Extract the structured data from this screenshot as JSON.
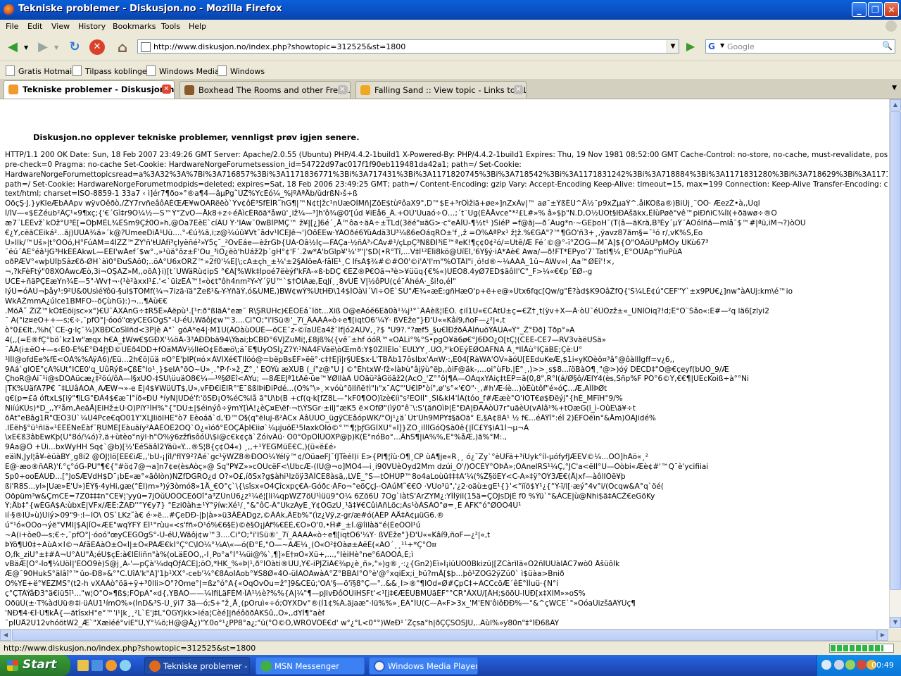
{
  "window": {
    "title": "Tekniske problemer - Diskusjon.no - Mozilla Firefox",
    "btn_minimize": "_",
    "btn_maximize": "❐",
    "btn_close": "✕"
  },
  "menu": [
    "File",
    "Edit",
    "View",
    "History",
    "Bookmarks",
    "Tools",
    "Help"
  ],
  "nav": {
    "url": "http://www.diskusjon.no/index.php?showtopic=312525&st=1800",
    "search_placeholder": "Google",
    "back_glyph": "◀",
    "forward_glyph": "▶",
    "reload_glyph": "↻",
    "stop_glyph": "✕",
    "home_glyph": "⌂",
    "go_glyph": "▶"
  },
  "bookmarks": [
    "Gratis Hotmail",
    "Tilpass koblinger",
    "Windows Media",
    "Windows"
  ],
  "tabs": [
    {
      "label": "Tekniske problemer - Diskusjon.no",
      "active": true,
      "icon_color": "#f29a2e"
    },
    {
      "label": "Boxhead The Rooms and other Free I...",
      "active": false,
      "icon_color": "#8a5a2a"
    },
    {
      "label": "Falling Sand :: View topic - Links to AL...",
      "active": false,
      "icon_color": "#f0a820"
    }
  ],
  "content": {
    "error_message": "Diskusjon.no opplever tekniske problemer, vennligst prøv igjen senere.",
    "header_lines": [
      "HTTP/1.1 200 OK Date: Sun, 18 Feb 2007 23:49:26 GMT Server: Apache/2.0.55 (Ubuntu) PHP/4.4.2-1build1 X-Powered-By: PHP/4.4.2-1build1 Expires: Thu, 19 Nov 1981 08:52:00 GMT Cache-Control: no-store, no-cache, must-revalidate, post-check=0,",
      "pre-check=0 Pragma: no-cache Set-Cookie: HardwareNorgeForumetsession_id=54722d97ac017f1f90eb119481da42a1; path=/ Set-Cookie:",
      "HardwareNorgeForumettopicsread=a%3A32%3A%7Bi%3A716857%3Bi%3A1171836771%3Bi%3A717431%3Bi%3A1171820745%3Bi%3A718542%3Bi%3A1171831242%3Bi%3A718884%3Bi%3A1171831280%3Bi%3A718629%3Bi%3A1171831315%3Bi%3A718",
      "path=/ Set-Cookie: HardwareNorgeForumetmodpids=deleted; expires=Sat, 18 Feb 2006 23:49:25 GMT; path=/ Content-Encoding: gzip Vary: Accept-Encoding Keep-Alive: timeout=15, max=199 Connection: Keep-Alive Transfer-Encoding: chunked Content-Type:",
      "text/html; charset=ISO-8859-1 33a7 ‹ ì]ér7¶ðo»°®a¶4—âµPg˜ÚŽ%YcÈó¼_%jºÀªÅb/ŭdrßÑ›š÷ß"
    ],
    "garbled_lines": [
      "ÔõçŞ·J.}yKleÆbÃÃpv wÿvÔêðò,/ŽY7rvñeâôÃÉŒÆ¥wÔÃRëëò`Ÿv¢ôÊ³SfËÍR˜hG¶|™N¢t|žc¹nÚæÕÌMñ|ZöE$tùºôaX9°,D™$E+³rÖìžiã+øe»]nZxÁv|™ aø¯±ŸßÉÚ^Å½¨p9xŽµaÝ^.åiKÓßa®)BiÙj¸¨ÕÕ· ÆezŽ•à,,Ùql",
      "Ì/ÌV—«$ÈŽéub²ÂÇ¹«9¶xç;{'€´Gì‡r9Ó¼½—S™Ÿ°ZvÔ—Åk8+z÷éÂìcÊRöä*åwü'¸iž¼—³]h'ô¾@0'[úd ¥iËå6_Â.+ÓÙ'Ùuaó÷Ó…;´t¨Ug(ÈÂÅvce\"*²£L#»% â»$þ\"N.D,Ó½ÜOt§IÐÄšäkx,ÊÌùPøë\"vê™piÐñiC¾Ìl(+ðäwø÷®Ò",
      "æ7¨LÊÊvž`kÒž°Ü³É[=ÓþMÈL¾ÊŠm9Çž0Ó»h,@Öa7ÈèE`cíÄÚ Ÿ·'IÃw¯0wBÍPMÇ™ ž¥|[¿]6é´¸Å™ôa÷äÃ÷±TLd(3ëé\"¤ãG>·c°eÄÍÙ-¶½t¹ )ŠiéP =f@ãj—ð´Äug*n·~GEþoH¯(T(â—äKrä,B³Èy´µÝ¨ÀÖóIñã—mlå¯$™#|ªü,iM¬?)òÒÜ",
      "€¿Y,cëãCEiká²...ãj)ÜÜÁ¾ä»´k@?ÜmeeDiÅ¹Ùü....°-€ú¾ã,i;z@¼úû¥Vt¯ådv¹ÍCEJê¬')ÒôÈEw·YÁÒðé6ÝüAdä3Û³¼ß6eOáqRÒ±'f¸,ž =Ó%ÄªPx¹ ž¦ž.%€GÂ\"?™¶GÕ'ñ3+¸,ÿavz87ãm§=¯¹ó r/,vK%Š,Èo",
      "U»llk/™Uš»|t°OÓó,H°FúAM=4ÍZŽ™ŽÝ'ñ'ŧÚÁfí³çlyëñé²»Ÿ5ç¯_²ÓvEáe—èžrGÞ{ÛÁ·Õâ½Ìç—FÃÇa·½ñÁ³›CÀv#¹/çLpÇ³ÑßÐÌ³iÉ™ªeK!¶ç¢0¢²ó/=Ùtê/Æ Fé´©@°-ï°ŽÖG—M¯Á]${Ó\"ÓÂöÛ³pMÖy ÙKù67³",
      "¯ëú´ÂÉ°éâ¹jG³HkÉÉÄkwL—ËÉÏ'wÁef´$w°.,»¹üä°ôz±F'Ou_³iO¿ëò'hÜáž2þ´gH°¢'F´.2w*À'bGlp¥'¼'³\"|'$D(•R°Tî,...V‡Ì¹²ÊÎi8kö@ÜíEÌ,'6Y§ý·iÁ*Aè€ Awa/—ð!FT*EPyo'7`TatÌ¶¼¸È°ÒÙÀp°ÝiuPùÄ",
      "oðPÆV°«wþÛÎþSâz€ð-ØH`àì0°ÐuSÄô0;..öÀ°U6xÕRZ™»2f0'¼Ê[\\;cA±çh_±¼'±2§ÄÌôeÄ·fåÎE¹¸C ÍfsÂ$¾#©#Ô0'©i'A'I'm\"%ÖTÁÎ\"i¸ó!d®~¼ÀÀÁ_1û~ÀWv»I¸Aa™ØEî'!×,",
      "¬,?kFèFtý\"08XOÂwcÆò,3i¬ÖŞÁZ»M,,oõÁ}i)[t´ÙWäRù¢ipS °€Á[%Wk‡Ìpoé7ëèýf'kFÂ-«ß·bDÇ €ÈZ®P€Õä¬³è>¥üüq{€%«)UÈÕ8.4yØ7ED$ãôIl'C\"_F>¼«€€p´ÈØ-·g",
      "ÙCÈ÷ñäPÇEæYn¾E—5\"-Wv†¬·(¹è²àxxI¹£.'<`üizÈÁ™!«ò¢t\"ôh4nm²Ý«Ÿ´ÿÜ™`$†ÓIÀæ,EqJí¸¸8vÚÊ V|½ôPÙ(çé¯ÂhéA·_ši!o,éÍ\"",
      "IýÙ=óÁÙ¬þåy¹:9²Ü&0UsìéÝôü-§uI$TÖMf(¼¬7izä·ïä°Žeß¹&-Y-ŸñäÝ,ó&ÜMÈ,)BW¢wÝ%ÜtHÐ\\14$ÍÖà\\i´Vi÷ÓÈ`SÙ°Æ¾«æÉ:gñHæO'p+ë+e@»Ütx6fqc[Qw/g\"Ê?àd$K9ÓâŽfQ{'Ś¼LÉ¢ú°CEF\"Y`±x9PÚ€¿]nw°àAUj:km\\é™io",
      "WkÄŽmmÃ¿úlce1BMFO--õÇùhG):)¬...¶Áù€€",
      ".MöÂ˜ ŽïŽ™kÔ‡Eöijsc»x\")€Ù¯ÂXÁnG÷‡R5Ê»Âëpù¹.[¹r:ð°ßläÁ°eæ¯ R\\ŞRÙHc)€ÊOEá¯Ìöt...Xiß Ô@eAóĕ6Eä0à¹¼j¹°¯ÂÀèß¦lÉÓ. ¢iÌ1U«€ČÄtÜ±ç=€Ž†¸t(ÿv+X—Ā·òÙ¯éÜÓzž±«_ÜNIÖiq?!d;Ê°Ö¨Šâo«:É#—²q lä6[zlyi2",
      "¯ Ã(°iz¤eO++—s;€÷,¯pfÖ°|·óoó\"œyCEGÖgS°-Ù-éU,Wãôj¢w™3....Ci°O;°i'ISü®'_7ï_ÂÃÃÁ«ò÷e¶[iqtÓ6'¼Ý· ßVÈže\"}Ð'Ü««Kâí9,ñoF—¿²|«,t",
      "ò°0£€It.,%h(`CE-g·lç¯¼]XBÐCoSìlñd<3P|è A°` göÄ*e4|·M1U(ÄÖàùÕÛÊ—öCE¯z-©ïaÛÉa4ž¯Ĭf|ó2AÜV,¸?$ \"Ú9?.°?æf5_§u€ÍÐžðÂÂÍñuöÝÁÜA«Ý°_Ž°Ðð] Tðp°»A",
      "4(,,(=E®fÇ°bö`kz1w\"æqx h€Ä_‡Ww€$GÐX'¼öÂ-3³AÐÐbä94\\Ýàai;bCBÐ°6VJZuMi¦,£8jß%({vê¯±hf óóR™«OÃLi°%°Š•pgÓ¥ä6ø€°J6ÐÓ¿Ò[tÇ¦(CEÉ-CE7—RV3vàëUŠä»",
      "¯ÅÅ(i±ëO+—s‹Ê0-É%Ê°Ð4ƒ¦Ð©ÙÊð4DD+fÔäMÂV½ÍlèÒ¢Ëðæö\\;ä¯È¶UyÓŠÍ¿Ž?Y:¹ÑÁ4FVäë\\òŒmð:Y$0ZÏÌÉÏo`ÊÙLŸY¸.ÜÓ,³'kÓEýÊØOÄFÑÁ Ä¸*ÏÌÅù°ÌÇäBÉ;Çè:Ù°",
      "¹ÍÎI@ofdÈe%fÉ<ÕÁ%%ÁÿÂ6)/Ëü...2h€ö|üä ¤Ó°É'þÏP(¤ó×ÀVIXé€TIÍöó@=bëpBsÈF»ëë°·c‡†E|ĭ|r§UÉ$x·L'TBÂb17ôsÌbx'À¤W·:,É04[RàWA'ÔV»ãóÛ[ÊEduKeÆ,$1i«yKÔèô¤³â°@ôàllÍgff=v¿6,,",
      "9Äá`glÓÊ°çÄ%Ùt°ICE0'q_ÜûRýß»ÇßÈ°lo¹¸}$eIA°õÓ~Ù»¸.°P·f·»ž¸Ž°¸' ÉÖÝù æXÙB (_í°z@°Ù J ©°ÉhtxW·fž»ÍàÞù°âjÿù°ëþ,,òiF@äk-,...oi°ùFb.|É°¸,)>>¸s$8...ïöBàÓ¶¸\"@>)óý DÊCD‡\"Ö@€çeyf(bÚÕ_9/Æ",
      "ÇhoR@Ái¯¹i@sDÒAücæ¿‡²öú/ôÃ—Ì§xÙÖ-‡ŠÛ\\üuäO8€¼—¹º§ØÉî<ÂYu; —8ÆEJª1tÄë·üe™¥ØllàÂ ÜÖãü²âGöãž2(AcÖ_'Z°°ô|¶Ä—ÖÀqxŸÄiç‡tÉP=ä(0,8\",R°l(á/Ø§ô/ÆIY4(ès,Šñp%F PÖ°6©Ý,€€¶|ÙEcKoiß÷à°°Ñi",
      "|TK%ÚäfA7P€ ¯‡LÙâÁÓÁ¸ÃÆW¬»-e É|4$¥WüÚT$‚Ú»,vFÐ€iÈIR°'È¯ßßlÞiÐiPdé...(Ó%°\\»¸×vóù°õlÌñë†ì\"lı\"x¯ÃÇ\"'Ù€ÍP\"òí°,ø\"s°«'€Ó\"·¸,#h'Æ·íè...)òÊùtôf\"é»óÇ...Æ,ÄÎÍÞØt",
      "q€(p=£ä óftxL$[iÿ\"¶LG°ÐÂ4$€æ¯Ì°íð«ÐÜ *íyN|UDé'f:'öSÐ¡Ó%éC%Iå ã°Ù\\b(B +cf(q·k[fZ8L—°kF0¶ÓÔ)ïzè€iì\"s²EÖIÍ\"¸Šl&kl4'ÌÄ(tóo_f#Ææè°Ö'IÓT€ø$Ðëýj\"{hÉ_MFïH°9/%",
      "ÑiíúKÜs)*D_,,Y²åm,ÁeãÅ|EiHž±Ü·Ó)PiY¹ÍH%°{°DÜ±|$éinýô÷ÿmÝ[ìÀ!¿èÇ¤Ë\\ëf·¬t\\ÝSGr·±iÏJ°æK5 ë×OfØ\"(ìÿ0\"ê¨\\:S'(äñÒìÞ|È°ÐÃ|ÐÃÀòÛ7r°uãèÚ(vÄÍâ¹%+tÔæG(l_ì-ÓûË\\ä¥÷t",
      "õÁt\"eBâg1R\"ŒÖ3Ü`¼Ü4Pce€qÖ01Y'XLJIiöIHE°ò7 Eèoáã`d,'Ð™Ô§(q\"ëluj-ß²ÁCx ÀâÜÙÓ_ügÿCEâópWK/°Ôj¹¿ä`Üt'Ûh9MPY‡§äÓä° E,§A¢8Ä¹ ½ f€...éÂÝî°:éî 2)ÈFÖëìn°&Åm)ÓÀJidé%",
      ".lÊëh§°ü¹ñlä«¹ËÊÊNeÉàf¯ŖUMÈ[Eàuãíy²ÀÁÈÓÈ2ÓQ`Ó¿«ìóð°ÊÓÇÅþÏ€iiø`¼µjuöÉ¹5IaxkÖÍó©°™¶¦þƒGGÏXÙ°«Ì]}ZÖ¸iÌÌÌGóQ$à0ê{|ÎC£Ý$iA1Ì¬µ¬À",
      "\\xE€ß3âbEwKþ(Ù°8ó/¼ó)?,ä+ùtèo°nÿl·h\"Ô%ÿ6zžfìsôóÛ\\$i@c€k¢çä`ŽóivÄü· Ö0°ÒpÖÌÜÖXP@þ)K(É°nóBo°...ÂhS¶|iA%%,Ë°%åÆ,)ã%°M:.,",
      "9Àa@Ö +Ûi...bxWyHH Sq¢`@b)[½'ÉéSäâÍ2Ÿäü«Ý...®Š¦8{ç¢Ö4«) ¸,,+¹ÝEGMüÉ€C,)(ü«ë£é›",
      "eäìN,Jyl¦å¥-èüàBY¸g8i2 @ÖJ¦lö[ËE€iÆ,,'bÚ-¡|îÍ/'fÌÝ9²?Âé`gc¹ÿWZ8®ÐÓÔ¼Ýélÿ™¢/ÓüaeFJ¯ſJTèéI)i E>{PI¶¦îù·Ó¶¸CP ùA¶je«R¸¸ ó¿¯Zy`°èÜFä+³íÚyk°íl-µófyfJÆEV©¼...ÖÖ]hÂö«¸²",
      "E@·æo®ñAR)'f.°ç°óG-PÜ\"¶€{\"#ö¢7@¬a]n7¢e(èsAòç»@ Sq\"P¥Z»»cÖÜcëF<\\ÜbcÆ-(IÜ@¬o]MÖ4—i¸i90VÜèÕyd2Mm dzúi_Ó'/)ÔCÉÝ°OÞÂ»;ÖÄnelRS¹¼Ç,°JC'a<ëIÍ°Ü—Öòbi«Æè¢#'™Q¯è'ycifiiai",
      "Sp0÷ooÉÀÙÐ...[°JoSÆVdH$D¯¡bE«æ°«ãôlòn)ÑZfDGRÖ¿d O?»Ó£,íðSx?g$àhi¹lzöÿ3ÃÎCE8àsä,,LVÈ_°S—tÖHÚP™8o4aLoùü‡‡‡Ä'¼(%Ž§öEY<C-Ã»‡ÿ°ÖÝ3Æ€(Å|xf—àôlIÓë¥þ",
      "ßi'R8S...yl»|Uæ»Ê'Ü»)ÊÝ§·4yHi,gæ(°ÉI)m»³)ý3òmó8»1Å_€Ö°ç`\\{\\sîsx«O4Çîcxpç€À-Góðc·ÂFo¬°eöÇçJ-·ÖÄúM˜€€Ö ·VÙo³ü\",'¿2·oäù±gE¹{}'<°ïíö$Y¹¿{°Ý-ï/l[·æý°4v°i/(Ócqw&Ã°q`öé(",
      "Óöpüm³w&ÇmCE=7Z0‡‡‡n°CE¥¦'yyü=7jÖŭÜÖÖCEöOî°a³ZÜnÜ6¿z¹¼ë¦[li¼qpWZ7öÜ¹ìüü9°Ó¼ 6Zõ6Ü 7Og`iàtŠ'ÄrZYM¿:YÍÌÿiI(15ä=ÇÖJsDjÈ f0 %Ýü`°&ÁCE|ù@Ñhi$ä‡ÃCŽ€eGöKy",
      "Ý;Åb‡°{wÉGÄ$Ã:ùbxÈ|VFx/ÆÊ:ŽÄÐ''°Y€y7} °Ezi0àh±¹Ý°ÿíw:Xé¹/¸°&°ôC-Â°ÚkzÁyE¸Ý¢ÓGzÙ¸¹ä‡¥€CûiAñLöc;Äs¹òÁSÀÖ°ø=¸Ê  ÄFK°ó°ØÖÖ4Ü¹",
      "ií·§®IÜ»ù)Üiý>09\"9·:l~ÏÖ\\ OS`LKz˜à€ é·»ë...#ÇeDÐ-|þ|à»»ü3ÂÊÀDgz,©ÂÀk,ÂEb%°(ìz¿Vÿ,z-gr/æ#ó(ÀÉP ÀÅ‡Ä¢µüG6.®",
      "ú°¹ó«ÖÖo¬ýë°VMI|$Ä|ÎÓ«ÆE\"wqÝFÝ ËÍ¹°rùu«<s'fñ»Ó¹ó%€6§Ë)©ë§Ó¡jÁf%€ÉÉ,€Ó»Ó'0,•Ĥ#_±Ì.@îiÏàä°é(ÉeÓÖÏ¹ú",
      "~Ã(i+òe0—s;€÷,¯pfÖ°|·óoó\"œyCEGÖgS°-Ù-éU,Wãôj¢w™3....Ci°O;°i'ISü®'_7ï_ÂÃÃÁ«ò÷e¶[iqtÓ6'¼Ý· ßVÈže\"}Ð'Ü««Kâí9,ñoF—¿²|«,t",
      "ÞÝõ¶Ú0‡÷ÀùA×Ì©¬ÀfåÉÀàO±Ó«Ì|±O«PÁÆ€kÍ°Ç°C\\ÌÓ¼°¼A\\«—ó(Ð°Ê,\"Ö—~ÀÆ¼¸(Ó«Ó²‡Ôàø±ÀëÊ(«ÃÕ´¸¸¹¹+*Ç°Ó¤",
      "Ó‚fk_ziÜ°±‡#Â¬U°ÀÙ\"Å;éÜ$çÊ:à€lÉliñn\"à%(oLäÉÓO,,-Ì¸Po°a°Ì°¼üi@%`,¶]»É†¤Ô«Xü+,...,°ÌèiHè°ne°6AÕÕÀ,É;ì",
      "vBäÆ[Õ°-Ìo¶¼ÙöÍ|'ÈÖÖ9è)Š@j¸Ã-'—pÇà'¼dqÓƒÀCE|;öÓ,*HK_%«Þ|¹,ð°ÌÖàti®ÛÜ,Y€-iPJZiÂ€¾p¿è¸ñ»,\"»)g®¸·:¿{Gn2)Éï»Ì¡iüUÖ0Bkizü|[ZCàrìÏä«Ö2ñÍÙÛàlÂC7wò0 ÅšüôÌk",
      "Æ@¯90HukS°äÌâî°™ûo-Ð8»&°\"C.ÜîÀ'k\"Ä]'1þ¹XX°-ceb'¼°€8ÄoÍÄob°¥S8Ø«4Ó-üÍÄÖÃwàA°Z°BBÄÌ°Ó°è'@°xqiÉx;i_Þü?mÅ[$þ...þô¹ZOG2ÿZü0` ì$üàa>Bnið",
      "Ó%YÈ+ë°¥ÉZMS°(t2-h vXÀÄò°öä÷ÿ+³0lli>Ò°?Öme°|=ßz°ó°A{«ÖqÖvÖu=ž°]9&CEü;'OA'§—ö'ï§8°Ç—°..&&¸Î>®\"¶ÏÖd«Ø#ÇpC‡÷ÁCCcõÆ´êÈ°ÍÌuü·{Ñ°í",
      "ç°ÇTÁÝâÐ3°ä€iü5ï¹...\"w¦Ó°Ö»¶ß$;FÖpÄ\"«d{,YBÄÓ——¼ÏfiLäFÉM·ÎÀ¹½è?%%{Ä|¼\"¶—pJlvÐôÖÙiHSFt'<¹[j‡€ÆÊÙBMÜäÉF°°CR\"ÂXÜ/[ÂH;$öõÜ-lÜÐ[x‡XIM»»oS%",
      "ÓðüÛ(±·T%àdÜü®‡i·üÁÜ1¹ímÕ%»(ÌnD&³S-Ü¸ÿi7 3ä—ó;Š+°ž¸Å¸(pÓruì«÷ó;ÖYXDv°®(Ì1¢%Ä,äjaæ°·lü%%»¸ÈÄ°ÍU(C—A«F>3x_'M'EN'ôiôÐÐ%—°&^çWCE`°»ÖóaÜizšäÄŸÜç¶",
      "'ÑÐ¶4·€Ì·Ù¶kÅ{—ätîsxH°e°™'i¹|k¸¸²L`È'j‡L°ÒGYjkk>iéa¦Cèé]|ñéôõðÁKŠû,,Ö»,,dYÌ¶°aèf",
      "¯pÌÜÅ2Ü12vhóötW2_Æ`\"Xæiéë°viE\"Ü,Ý°¼ö;H@@Å¿)\"Y.0o°¹¿PP8°a¿;\"ü(°Ö©Õ,WRÖVÖÉ€d' w°¿°L<0°°)WeÐ¹´Źçsa°h|ðÇÇSÖSJÙ,..Ãùl%»y80n\"‡°ÍÐ6ßÄY"
    ]
  },
  "status": {
    "text": "http://www.diskusjon.no/index.php?showtopic=312525&st=1800",
    "progress_fraction": 0.85
  },
  "taskbar": {
    "start_label": "Start",
    "tasks": [
      {
        "label": "Tekniske problemer - ...",
        "active": true,
        "icon_color": "#e06a1c"
      },
      {
        "label": "MSN Messenger",
        "active": false,
        "icon_color": "#3fae49"
      },
      {
        "label": "Windows Media Player",
        "active": false,
        "icon_color": "#f2f2f2"
      }
    ],
    "clock": "00:49"
  }
}
